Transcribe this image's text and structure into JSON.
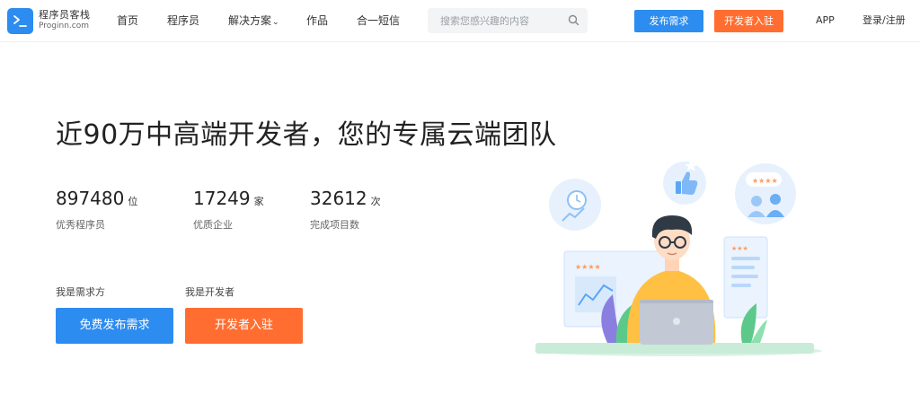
{
  "brand": {
    "name_cn": "程序员客栈",
    "name_en": "Proginn.com",
    "primary_color": "#2d8cf0",
    "accent_color": "#ff6e30"
  },
  "nav": {
    "home": "首页",
    "programmers": "程序员",
    "solutions": "解决方案",
    "works": "作品",
    "sms": "合一短信"
  },
  "search": {
    "placeholder": "搜索您感兴趣的内容",
    "icon": "search-icon"
  },
  "header_actions": {
    "publish": "发布需求",
    "join_dev": "开发者入驻",
    "app": "APP",
    "login": "登录/注册"
  },
  "hero": {
    "title": "近90万中高端开发者，您的专属云端团队"
  },
  "stats": [
    {
      "value": "897480",
      "unit": "位",
      "label": "优秀程序员"
    },
    {
      "value": "17249",
      "unit": "家",
      "label": "优质企业"
    },
    {
      "value": "32612",
      "unit": "次",
      "label": "完成项目数"
    }
  ],
  "cta": {
    "client_label": "我是需求方",
    "client_button": "免费发布需求",
    "dev_label": "我是开发者",
    "dev_button": "开发者入驻"
  }
}
